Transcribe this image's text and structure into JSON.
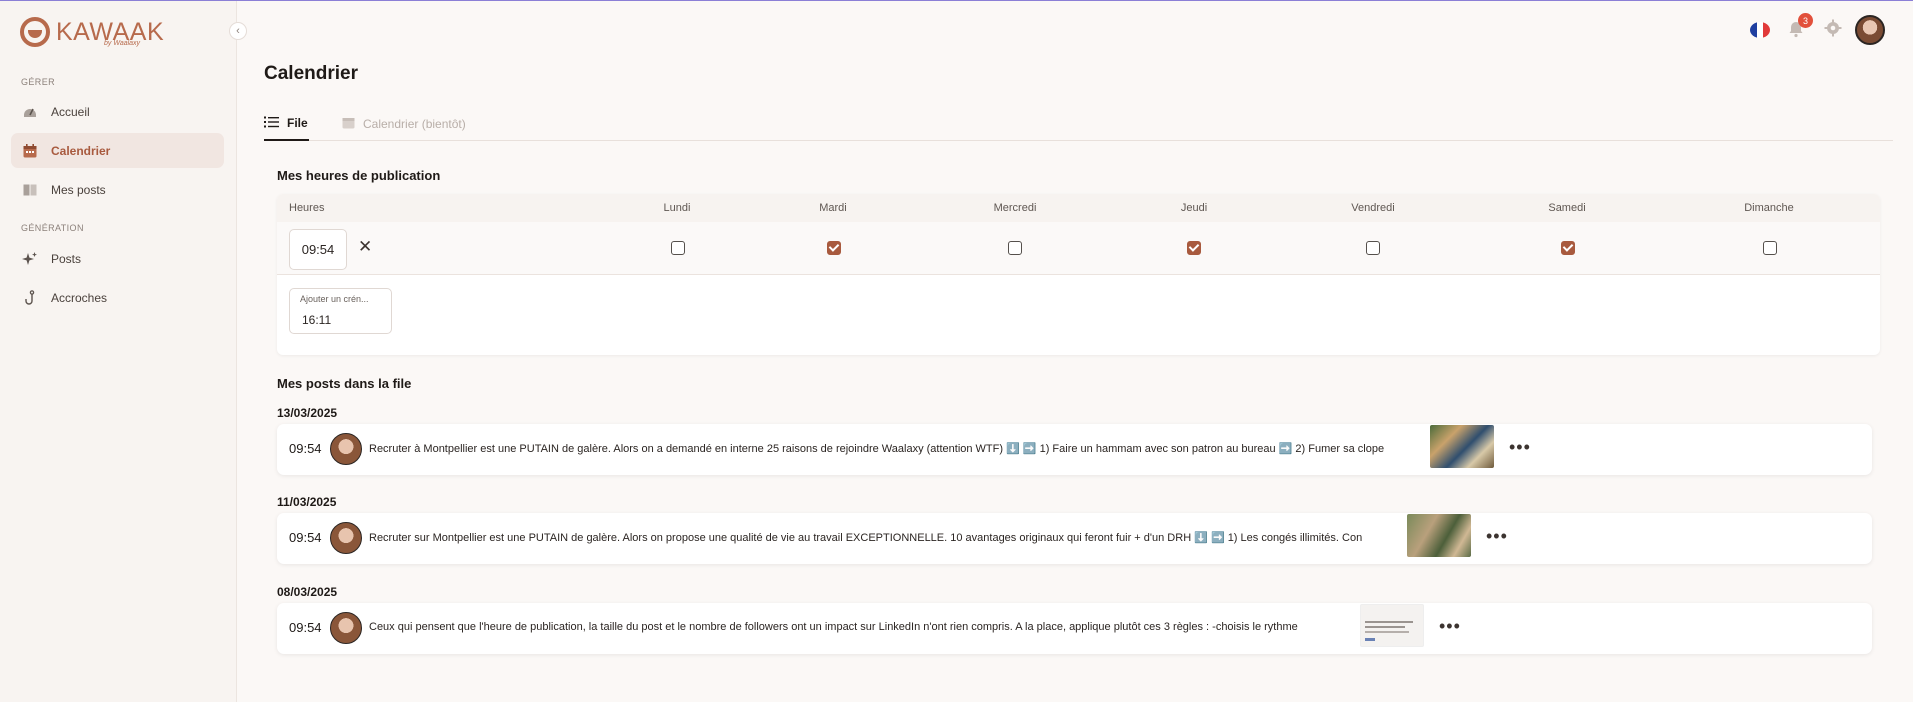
{
  "app": {
    "logo_text": "KAWAAK",
    "logo_sub": "by Waalaxy",
    "collapse_icon": "‹"
  },
  "sidebar": {
    "sections": [
      {
        "title": "GÉRER"
      },
      {
        "title": "GÉNÉRATION"
      }
    ],
    "items": [
      {
        "label": "Accueil",
        "icon": "home-gauge-icon"
      },
      {
        "label": "Calendrier",
        "icon": "calendar-icon",
        "active": true
      },
      {
        "label": "Mes posts",
        "icon": "book-icon"
      },
      {
        "label": "Posts",
        "icon": "sparkles-icon"
      },
      {
        "label": "Accroches",
        "icon": "hook-icon"
      }
    ]
  },
  "topbar": {
    "notification_count": "3",
    "language": "fr"
  },
  "page": {
    "title": "Calendrier",
    "tabs": [
      {
        "label": "File",
        "active": true
      },
      {
        "label": "Calendrier (bientôt)",
        "disabled": true
      }
    ]
  },
  "schedule": {
    "title": "Mes heures de publication",
    "hours_header": "Heures",
    "days": [
      "Lundi",
      "Mardi",
      "Mercredi",
      "Jeudi",
      "Vendredi",
      "Samedi",
      "Dimanche"
    ],
    "slots": [
      {
        "time": "09:54",
        "checked": [
          false,
          true,
          false,
          true,
          false,
          true,
          false
        ]
      }
    ],
    "add_slot": {
      "label": "Ajouter un crén...",
      "value": "16:11"
    }
  },
  "queue": {
    "title": "Mes posts dans la file",
    "groups": [
      {
        "date": "13/03/2025",
        "posts": [
          {
            "time": "09:54",
            "text": "Recruter à Montpellier est une PUTAIN de galère. Alors on a demandé en interne 25 raisons de rejoindre Waalaxy (attention WTF) ⬇️ ➡️ 1) Faire un hammam avec son patron au bureau ➡️ 2) Fumer sa clope"
          }
        ]
      },
      {
        "date": "11/03/2025",
        "posts": [
          {
            "time": "09:54",
            "text": "Recruter sur Montpellier est une PUTAIN de galère. Alors on propose une qualité de vie au travail EXCEPTIONNELLE. 10 avantages originaux qui feront fuir + d'un DRH ⬇️ ➡️ 1) Les congés illimités. Con"
          }
        ]
      },
      {
        "date": "08/03/2025",
        "posts": [
          {
            "time": "09:54",
            "text": "Ceux qui pensent que l'heure de publication, la taille du post et le nombre de followers ont un impact sur LinkedIn n'ont rien compris. A la place, applique plutôt ces 3 règles : -choisis le rythme"
          }
        ]
      }
    ],
    "more_icon": "•••"
  },
  "colors": {
    "accent": "#a85a3e",
    "active_bg": "#f1e6e1",
    "notification": "#e2503b"
  }
}
